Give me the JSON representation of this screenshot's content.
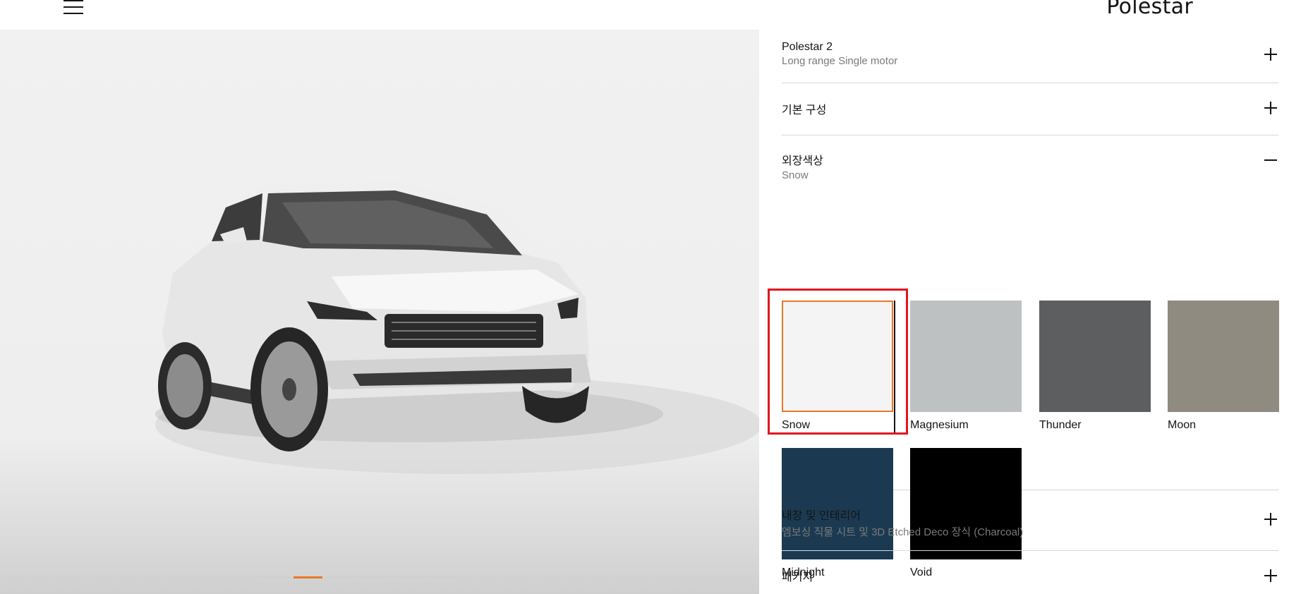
{
  "header": {
    "logo": "Polestar",
    "menu_icon": "hamburger-menu-icon"
  },
  "gallery": {
    "image_alt": "Polestar 2 Snow front view",
    "pages": 6,
    "active_page": 2,
    "accent": "#e8782b"
  },
  "config": {
    "model": {
      "title": "Polestar 2",
      "subtitle": "Long range Single motor"
    },
    "base": {
      "title": "기본 구성"
    },
    "exterior": {
      "title": "외장색상",
      "subtitle": "Snow",
      "swatches": [
        {
          "name": "Snow",
          "color": "#f4f4f4",
          "selected": true
        },
        {
          "name": "Magnesium",
          "color": "#bec1c2"
        },
        {
          "name": "Thunder",
          "color": "#5d5e60"
        },
        {
          "name": "Moon",
          "color": "#8f8b80"
        },
        {
          "name": "Midnight",
          "color": "#1b3a52"
        },
        {
          "name": "Void",
          "color": "#000000"
        }
      ]
    },
    "interior": {
      "title": "내장 및 인테리어",
      "subtitle": "엠보싱 직물 시트 및 3D Etched Deco 장식 (Charcoal)"
    },
    "package": {
      "title": "패키지"
    }
  },
  "colors": {
    "selection_highlight": "#e3141e",
    "selected_outline": "#e8782b"
  }
}
